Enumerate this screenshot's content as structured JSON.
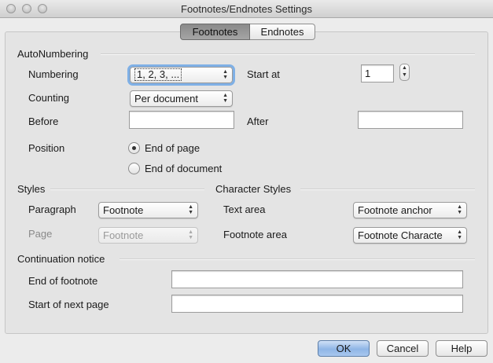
{
  "window": {
    "title": "Footnotes/Endnotes Settings"
  },
  "tabs": [
    {
      "label": "Footnotes",
      "active": true
    },
    {
      "label": "Endnotes",
      "active": false
    }
  ],
  "autonumbering": {
    "heading": "AutoNumbering",
    "numbering_label": "Numbering",
    "numbering_value": "1, 2, 3, ...",
    "start_at_label": "Start at",
    "start_at_value": "1",
    "counting_label": "Counting",
    "counting_value": "Per document",
    "before_label": "Before",
    "before_value": "",
    "after_label": "After",
    "after_value": "",
    "position_label": "Position",
    "position_options": [
      {
        "label": "End of page",
        "selected": true
      },
      {
        "label": "End of document",
        "selected": false
      }
    ]
  },
  "styles": {
    "heading": "Styles",
    "paragraph_label": "Paragraph",
    "paragraph_value": "Footnote",
    "page_label": "Page",
    "page_value": "Footnote"
  },
  "character_styles": {
    "heading": "Character Styles",
    "text_area_label": "Text area",
    "text_area_value": "Footnote anchor",
    "footnote_area_label": "Footnote area",
    "footnote_area_value": "Footnote Characte"
  },
  "continuation": {
    "heading": "Continuation notice",
    "end_label": "End of footnote",
    "end_value": "",
    "start_label": "Start of next page",
    "start_value": ""
  },
  "buttons": {
    "ok": "OK",
    "cancel": "Cancel",
    "help": "Help"
  },
  "colors": {
    "default_button": "#8fb5e6",
    "focus_ring": "#7fb0e6"
  }
}
